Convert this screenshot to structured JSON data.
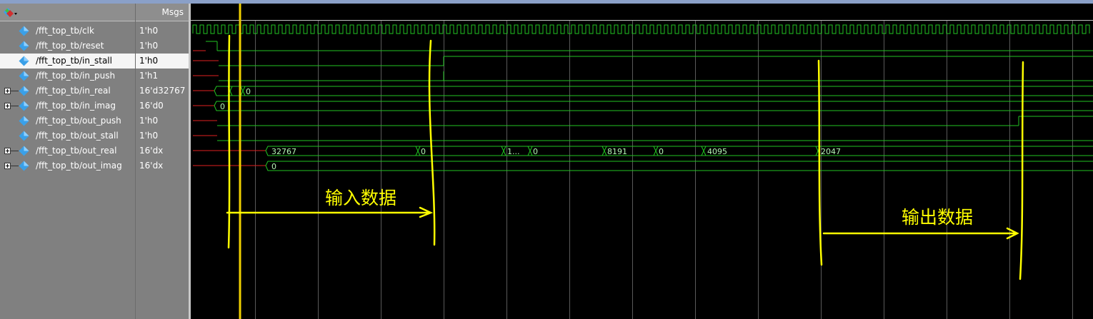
{
  "header": {
    "msgs_label": "Msgs"
  },
  "signals": [
    {
      "name": "/fft_top_tb/clk",
      "value": "1'h0",
      "expandable": false
    },
    {
      "name": "/fft_top_tb/reset",
      "value": "1'h0",
      "expandable": false
    },
    {
      "name": "/fft_top_tb/in_stall",
      "value": "1'h0",
      "expandable": false,
      "selected": true
    },
    {
      "name": "/fft_top_tb/in_push",
      "value": "1'h1",
      "expandable": false
    },
    {
      "name": "/fft_top_tb/in_real",
      "value": "16'd32767",
      "expandable": true
    },
    {
      "name": "/fft_top_tb/in_imag",
      "value": "16'd0",
      "expandable": true
    },
    {
      "name": "/fft_top_tb/out_push",
      "value": "1'h0",
      "expandable": false
    },
    {
      "name": "/fft_top_tb/out_stall",
      "value": "1'h0",
      "expandable": false
    },
    {
      "name": "/fft_top_tb/out_real",
      "value": "16'dx",
      "expandable": true
    },
    {
      "name": "/fft_top_tb/out_imag",
      "value": "16'dx",
      "expandable": true
    }
  ],
  "bus_labels": {
    "in_real": [
      "0"
    ],
    "in_imag": [
      "0"
    ],
    "out_real": [
      "32767",
      "0",
      "1...",
      "0",
      "8191",
      "0",
      "4095",
      "2047"
    ],
    "out_imag": [
      "0"
    ]
  },
  "annotations": {
    "input_label": "输入数据",
    "output_label": "输出数据"
  },
  "colors": {
    "signal_icon": "#3aa0e8",
    "wave_green": "#22c522",
    "wave_red": "#e02020",
    "cursor": "#f0d000",
    "annotation": "#ffff00"
  },
  "icons": [
    "wave-window-icon",
    "signal-diamond-icon",
    "expand-plus-icon"
  ]
}
